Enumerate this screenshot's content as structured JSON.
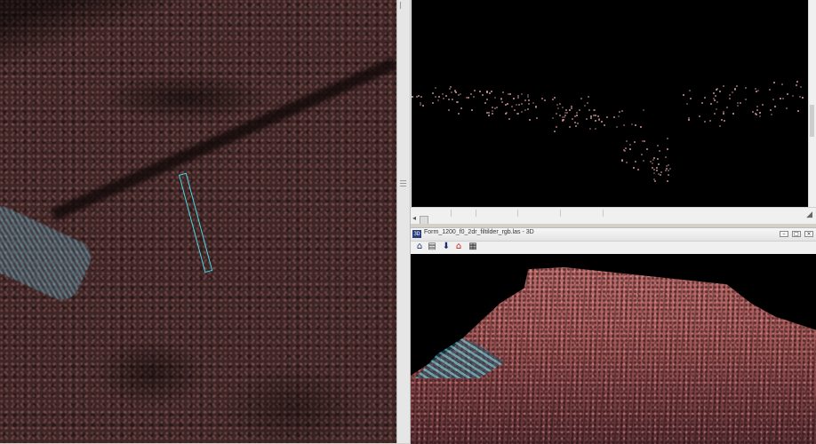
{
  "views": {
    "top_view": {
      "icon": "point-cloud-top-view"
    },
    "profile_view": {
      "icon": "point-cloud-profile"
    },
    "view_3d": {
      "window_title": "Form_1200_f0_2dr_filtilder_rgb.las - 3D",
      "app_icon_text": "3D",
      "toolbar_icons": [
        "home-icon",
        "open-file-icon",
        "down-arrow-icon",
        "red-home-icon",
        "layers-icon"
      ]
    }
  },
  "colors": {
    "selection_box": "#49d7e2",
    "points": "#e2a2a2",
    "background": "#000000"
  }
}
